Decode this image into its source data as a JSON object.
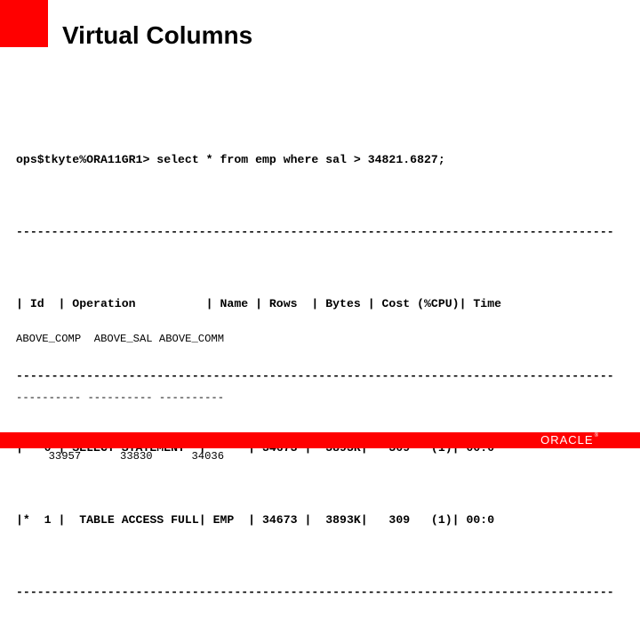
{
  "slide": {
    "title": "Virtual Columns"
  },
  "plan": {
    "command": "ops$tkyte%ORA11GR1> select * from emp where sal > 34821.6827;",
    "separator": "-------------------------------------------------------------------------------------",
    "header": "| Id  | Operation          | Name | Rows  | Bytes | Cost (%CPU)| Time",
    "rows": [
      "|   0 | SELECT STATEMENT  |      | 34673 |  3893K|   309   (1)| 00:0",
      "|*  1 |  TABLE ACCESS FULL| EMP  | 34673 |  3893K|   309   (1)| 00:0"
    ],
    "columns": [
      "Id",
      "Operation",
      "Name",
      "Rows",
      "Bytes",
      "Cost (%CPU)",
      "Time"
    ],
    "row_values": [
      {
        "id": "0",
        "operation": "SELECT STATEMENT",
        "name": "",
        "rows": "34673",
        "bytes": "3893K",
        "cost": "309",
        "cpu": "(1)",
        "time": "00:0"
      },
      {
        "id": "* 1",
        "operation": "TABLE ACCESS FULL",
        "name": "EMP",
        "rows": "34673",
        "bytes": "3893K",
        "cost": "309",
        "cpu": "(1)",
        "time": "00:0"
      }
    ]
  },
  "result": {
    "header": "ABOVE_COMP  ABOVE_SAL ABOVE_COMM",
    "separator": "---------- ---------- ----------",
    "values_line": "     33957      33830      34036",
    "columns": [
      "ABOVE_COMP",
      "ABOVE_SAL",
      "ABOVE_COMM"
    ],
    "values": [
      "33957",
      "33830",
      "34036"
    ]
  },
  "footer": {
    "logo_text": "ORACLE",
    "logo_mark": "®"
  },
  "colors": {
    "brand_red": "#ff0000",
    "text": "#000000",
    "background": "#ffffff"
  }
}
